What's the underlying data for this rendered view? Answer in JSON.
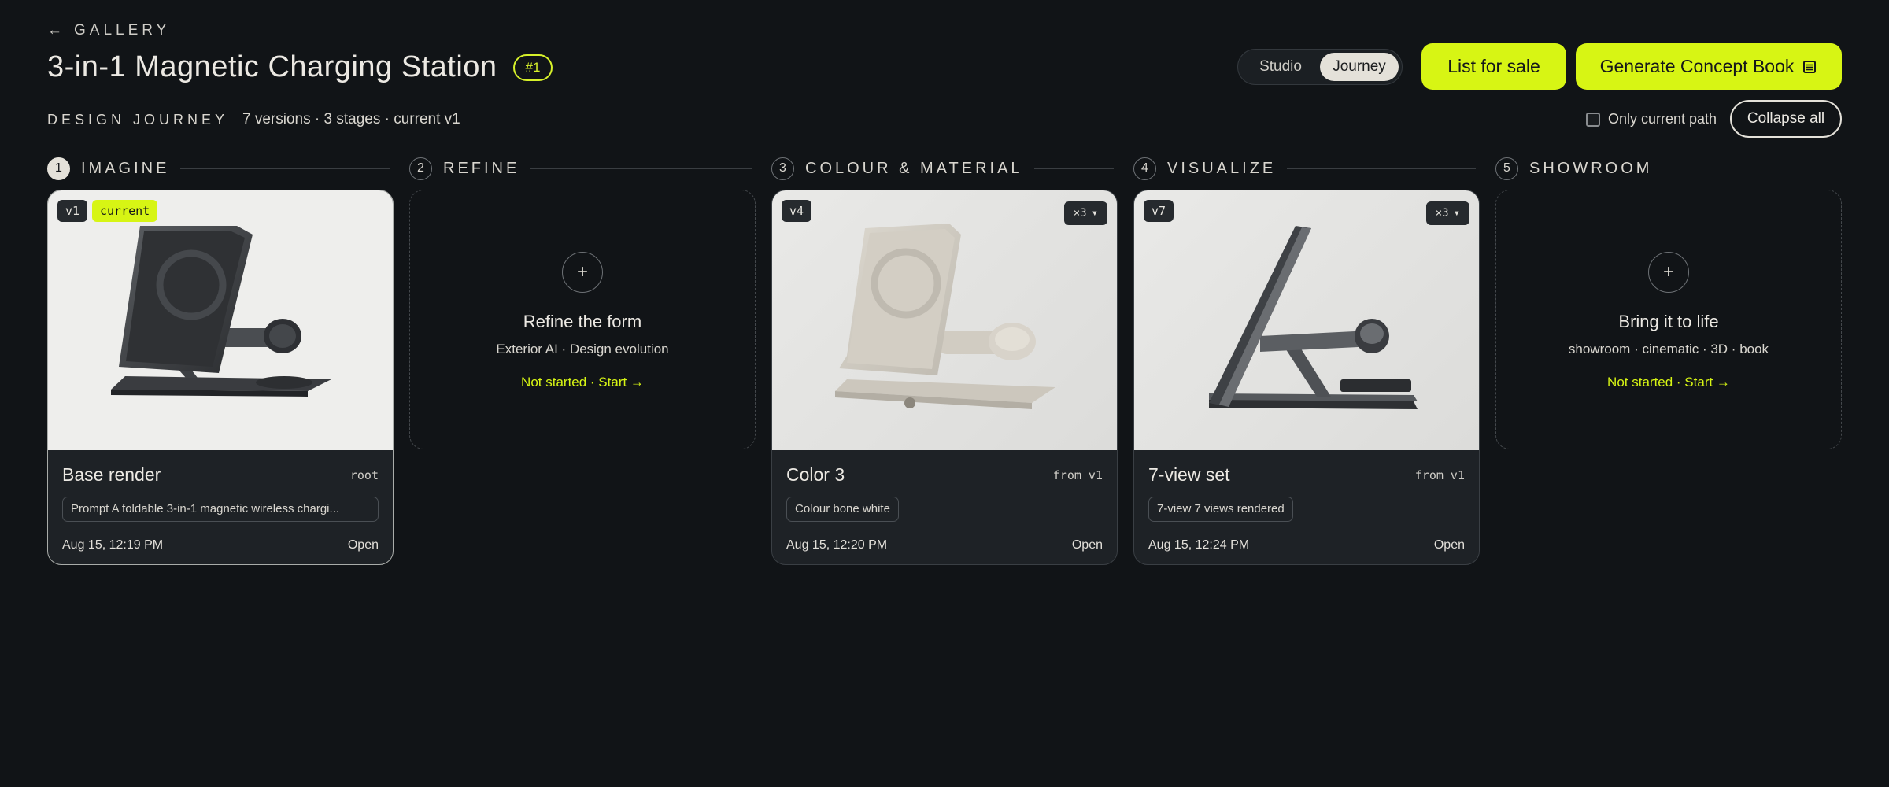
{
  "header": {
    "back_label": "GALLERY",
    "back_arrow": "←",
    "title": "3-in-1 Magnetic Charging Station",
    "rank": "#1",
    "section_label": "DESIGN JOURNEY",
    "meta": "7 versions · 3 stages · current v1"
  },
  "view_toggle": {
    "options": [
      "Studio",
      "Journey"
    ],
    "selected": "Journey"
  },
  "actions": {
    "list_for_sale": "List for sale",
    "concept_book": "Generate Concept Book",
    "concept_book_icon": "book-icon",
    "only_current_path": "Only current path",
    "only_current_path_checked": false,
    "collapse_all": "Collapse all"
  },
  "stages": [
    {
      "num": "1",
      "name": "IMAGINE",
      "active": true,
      "card": {
        "version": "v1",
        "current_label": "current",
        "title": "Base render",
        "from": "root",
        "chip": "Prompt A foldable 3-in-1 magnetic wireless chargi...",
        "date": "Aug 15, 12:19 PM",
        "open": "Open",
        "finish": "graphite"
      }
    },
    {
      "num": "2",
      "name": "REFINE",
      "empty": {
        "plus": "+",
        "title": "Refine the form",
        "sub": "Exterior AI · Design evolution",
        "status": "Not started · Start →"
      }
    },
    {
      "num": "3",
      "name": "COLOUR & MATERIAL",
      "card": {
        "version": "v4",
        "count": "×3",
        "title": "Color 3",
        "from": "from v1",
        "chip": "Colour bone white",
        "date": "Aug 15, 12:20 PM",
        "open": "Open",
        "finish": "bone white"
      }
    },
    {
      "num": "4",
      "name": "VISUALIZE",
      "card": {
        "version": "v7",
        "count": "×3",
        "title": "7-view set",
        "from": "from v1",
        "chip": "7-view 7 views rendered",
        "date": "Aug 15, 12:24 PM",
        "open": "Open",
        "finish": "graphite side"
      }
    },
    {
      "num": "5",
      "name": "SHOWROOM",
      "empty": {
        "plus": "+",
        "title": "Bring it to life",
        "sub": "showroom · cinematic · 3D · book",
        "status": "Not started · Start →"
      }
    }
  ],
  "colors": {
    "accent": "#d7f514",
    "background": "#111417",
    "card": "#1e2226"
  }
}
